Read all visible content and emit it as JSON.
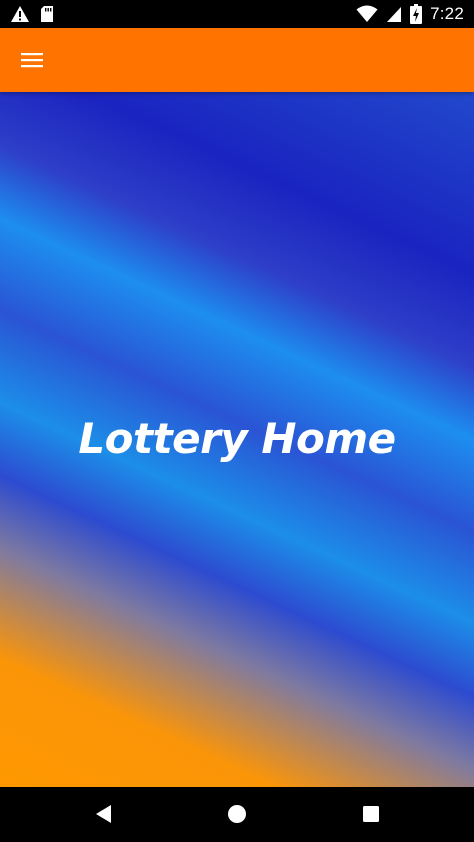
{
  "status_bar": {
    "time": "7:22",
    "icons": [
      "warning-icon",
      "sd-card-icon",
      "wifi-icon",
      "signal-icon",
      "battery-charging-icon"
    ]
  },
  "app_bar": {
    "menu_icon": "hamburger-menu-icon",
    "color": "#ff7300"
  },
  "main": {
    "title": "Lottery Home",
    "gradient_colors": [
      "#ff9800",
      "#2d4bd0",
      "#1c8ee8",
      "#1a24c0"
    ]
  },
  "nav_bar": {
    "buttons": [
      "back-icon",
      "home-icon",
      "recents-icon"
    ]
  }
}
